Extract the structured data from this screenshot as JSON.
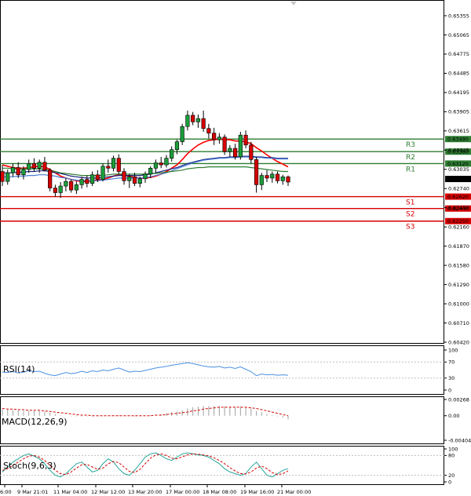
{
  "chart_data": {
    "type": "candlestick",
    "price_axis": {
      "ticks": [
        "0.65355",
        "0.65065",
        "0.64775",
        "0.64485",
        "0.64195",
        "0.63905",
        "0.63615",
        "0.63325",
        "0.63035",
        "0.62740",
        "0.62450",
        "0.62160",
        "0.61870",
        "0.61580",
        "0.61290",
        "0.61000",
        "0.60710",
        "0.60420"
      ],
      "range": [
        0.6035,
        0.6555
      ],
      "current_price": "0.62887"
    },
    "time_axis": {
      "labels": [
        "6:00",
        "9 Mar 21:01",
        "11 Mar 04:00",
        "12 Mar 12:00",
        "13 Mar 20:00",
        "17 Mar 00:00",
        "18 Mar 08:00",
        "19 Mar 16:00",
        "21 Mar 00:00"
      ]
    },
    "levels": [
      {
        "name": "R3",
        "value": 0.6349,
        "value_label": "0.63490",
        "color": "#2e7d32"
      },
      {
        "name": "R2",
        "value": 0.633,
        "value_label": "0.63300",
        "color": "#2e7d32"
      },
      {
        "name": "R1",
        "value": 0.6312,
        "value_label": "0.63120",
        "color": "#2e7d32"
      },
      {
        "name": "S1",
        "value": 0.6262,
        "value_label": "0.62620",
        "color": "#d50000"
      },
      {
        "name": "S2",
        "value": 0.6244,
        "value_label": "0.62440",
        "color": "#d50000"
      },
      {
        "name": "S3",
        "value": 0.6225,
        "value_label": "0.62250",
        "color": "#d50000"
      }
    ],
    "candles": [
      {
        "o": 0.63,
        "h": 0.631,
        "l": 0.6278,
        "c": 0.6285
      },
      {
        "o": 0.6285,
        "h": 0.6303,
        "l": 0.628,
        "c": 0.6298
      },
      {
        "o": 0.6298,
        "h": 0.6312,
        "l": 0.6292,
        "c": 0.6306
      },
      {
        "o": 0.6306,
        "h": 0.6314,
        "l": 0.629,
        "c": 0.6295
      },
      {
        "o": 0.6295,
        "h": 0.6308,
        "l": 0.6288,
        "c": 0.6303
      },
      {
        "o": 0.6303,
        "h": 0.6318,
        "l": 0.6298,
        "c": 0.6312
      },
      {
        "o": 0.6312,
        "h": 0.632,
        "l": 0.63,
        "c": 0.6305
      },
      {
        "o": 0.6305,
        "h": 0.6318,
        "l": 0.6298,
        "c": 0.6314
      },
      {
        "o": 0.6314,
        "h": 0.6322,
        "l": 0.63,
        "c": 0.6302
      },
      {
        "o": 0.6302,
        "h": 0.6305,
        "l": 0.627,
        "c": 0.6275
      },
      {
        "o": 0.6275,
        "h": 0.628,
        "l": 0.6262,
        "c": 0.6268
      },
      {
        "o": 0.6268,
        "h": 0.6284,
        "l": 0.626,
        "c": 0.6278
      },
      {
        "o": 0.6278,
        "h": 0.629,
        "l": 0.627,
        "c": 0.6285
      },
      {
        "o": 0.6285,
        "h": 0.6288,
        "l": 0.6268,
        "c": 0.6272
      },
      {
        "o": 0.6272,
        "h": 0.6285,
        "l": 0.6266,
        "c": 0.628
      },
      {
        "o": 0.628,
        "h": 0.6292,
        "l": 0.6274,
        "c": 0.6288
      },
      {
        "o": 0.6288,
        "h": 0.6294,
        "l": 0.6276,
        "c": 0.6282
      },
      {
        "o": 0.6282,
        "h": 0.63,
        "l": 0.6278,
        "c": 0.6295
      },
      {
        "o": 0.6295,
        "h": 0.6302,
        "l": 0.6284,
        "c": 0.6288
      },
      {
        "o": 0.6288,
        "h": 0.6312,
        "l": 0.6285,
        "c": 0.6308
      },
      {
        "o": 0.6308,
        "h": 0.6318,
        "l": 0.6298,
        "c": 0.6305
      },
      {
        "o": 0.6305,
        "h": 0.6324,
        "l": 0.63,
        "c": 0.632
      },
      {
        "o": 0.632,
        "h": 0.6326,
        "l": 0.6296,
        "c": 0.63
      },
      {
        "o": 0.63,
        "h": 0.6305,
        "l": 0.628,
        "c": 0.6286
      },
      {
        "o": 0.6286,
        "h": 0.6296,
        "l": 0.6275,
        "c": 0.6292
      },
      {
        "o": 0.6292,
        "h": 0.6298,
        "l": 0.6278,
        "c": 0.6282
      },
      {
        "o": 0.6282,
        "h": 0.6292,
        "l": 0.6276,
        "c": 0.6289
      },
      {
        "o": 0.6289,
        "h": 0.63,
        "l": 0.6283,
        "c": 0.6296
      },
      {
        "o": 0.6296,
        "h": 0.6308,
        "l": 0.629,
        "c": 0.6305
      },
      {
        "o": 0.6305,
        "h": 0.6318,
        "l": 0.6298,
        "c": 0.6313
      },
      {
        "o": 0.6313,
        "h": 0.6322,
        "l": 0.6305,
        "c": 0.631
      },
      {
        "o": 0.631,
        "h": 0.6325,
        "l": 0.6306,
        "c": 0.632
      },
      {
        "o": 0.632,
        "h": 0.6338,
        "l": 0.6315,
        "c": 0.6333
      },
      {
        "o": 0.6333,
        "h": 0.6348,
        "l": 0.6326,
        "c": 0.6345
      },
      {
        "o": 0.6345,
        "h": 0.6372,
        "l": 0.634,
        "c": 0.6368
      },
      {
        "o": 0.6368,
        "h": 0.6392,
        "l": 0.6362,
        "c": 0.6385
      },
      {
        "o": 0.6385,
        "h": 0.639,
        "l": 0.637,
        "c": 0.6375
      },
      {
        "o": 0.6375,
        "h": 0.6386,
        "l": 0.6366,
        "c": 0.638
      },
      {
        "o": 0.638,
        "h": 0.6392,
        "l": 0.636,
        "c": 0.6365
      },
      {
        "o": 0.6365,
        "h": 0.6372,
        "l": 0.635,
        "c": 0.6358
      },
      {
        "o": 0.6358,
        "h": 0.6366,
        "l": 0.634,
        "c": 0.6348
      },
      {
        "o": 0.6348,
        "h": 0.6358,
        "l": 0.6342,
        "c": 0.6352
      },
      {
        "o": 0.6352,
        "h": 0.6356,
        "l": 0.6325,
        "c": 0.633
      },
      {
        "o": 0.633,
        "h": 0.634,
        "l": 0.6322,
        "c": 0.6335
      },
      {
        "o": 0.6335,
        "h": 0.6342,
        "l": 0.6318,
        "c": 0.6322
      },
      {
        "o": 0.6322,
        "h": 0.636,
        "l": 0.6318,
        "c": 0.6355
      },
      {
        "o": 0.6355,
        "h": 0.6362,
        "l": 0.6335,
        "c": 0.634
      },
      {
        "o": 0.634,
        "h": 0.6345,
        "l": 0.6312,
        "c": 0.6318
      },
      {
        "o": 0.6318,
        "h": 0.6322,
        "l": 0.6268,
        "c": 0.628
      },
      {
        "o": 0.628,
        "h": 0.6298,
        "l": 0.6272,
        "c": 0.6294
      },
      {
        "o": 0.6294,
        "h": 0.6302,
        "l": 0.6284,
        "c": 0.629
      },
      {
        "o": 0.629,
        "h": 0.63,
        "l": 0.6283,
        "c": 0.6296
      },
      {
        "o": 0.6296,
        "h": 0.63,
        "l": 0.6282,
        "c": 0.6286
      },
      {
        "o": 0.6286,
        "h": 0.6295,
        "l": 0.628,
        "c": 0.6292
      },
      {
        "o": 0.6292,
        "h": 0.6294,
        "l": 0.6278,
        "c": 0.6284
      }
    ],
    "moving_averages": [
      {
        "color": "#ff0000",
        "values": [
          0.631,
          0.6308,
          0.6306,
          0.6305,
          0.6305,
          0.6306,
          0.6307,
          0.6308,
          0.6307,
          0.6303,
          0.6298,
          0.6293,
          0.629,
          0.6288,
          0.6286,
          0.6285,
          0.6285,
          0.6286,
          0.6287,
          0.6288,
          0.629,
          0.6293,
          0.6295,
          0.6294,
          0.6293,
          0.6291,
          0.629,
          0.629,
          0.6291,
          0.6293,
          0.6296,
          0.63,
          0.6305,
          0.631,
          0.6318,
          0.6327,
          0.6334,
          0.634,
          0.6344,
          0.6347,
          0.6348,
          0.6349,
          0.6348,
          0.6348,
          0.6346,
          0.6346,
          0.6345,
          0.6342,
          0.6336,
          0.6331,
          0.6325,
          0.632,
          0.6315,
          0.6311,
          0.6307
        ]
      },
      {
        "color": "#1a237e",
        "values": [
          0.6298,
          0.6298,
          0.6298,
          0.6299,
          0.6299,
          0.63,
          0.63,
          0.6301,
          0.6301,
          0.63,
          0.6298,
          0.6297,
          0.6295,
          0.6293,
          0.6292,
          0.6291,
          0.629,
          0.629,
          0.629,
          0.6291,
          0.6292,
          0.6293,
          0.6294,
          0.6294,
          0.6294,
          0.6294,
          0.6294,
          0.6295,
          0.6296,
          0.6298,
          0.63,
          0.6302,
          0.6304,
          0.6306,
          0.6309,
          0.6312,
          0.6314,
          0.6316,
          0.6318,
          0.6319,
          0.632,
          0.6321,
          0.6321,
          0.6322,
          0.6322,
          0.6323,
          0.6323,
          0.6323,
          0.6322,
          0.6322,
          0.6321,
          0.6321,
          0.632,
          0.632,
          0.632
        ]
      },
      {
        "color": "#4a7fd8",
        "values": [
          0.6292,
          0.6292,
          0.6292,
          0.6293,
          0.6293,
          0.6294,
          0.6294,
          0.6295,
          0.6295,
          0.6294,
          0.6293,
          0.6291,
          0.629,
          0.6288,
          0.6287,
          0.6286,
          0.6286,
          0.6286,
          0.6286,
          0.6287,
          0.6288,
          0.6289,
          0.629,
          0.629,
          0.629,
          0.629,
          0.629,
          0.6291,
          0.6292,
          0.6294,
          0.6296,
          0.6298,
          0.6301,
          0.6304,
          0.6307,
          0.631,
          0.6313,
          0.6315,
          0.6317,
          0.6318,
          0.6319,
          0.632,
          0.632,
          0.6321,
          0.6321,
          0.6322,
          0.6322,
          0.6322,
          0.6321,
          0.6321,
          0.632,
          0.632,
          0.6319,
          0.6319,
          0.6319
        ]
      },
      {
        "color": "#2e7d32",
        "values": [
          0.6305,
          0.6305,
          0.6304,
          0.6304,
          0.6304,
          0.6304,
          0.6304,
          0.6304,
          0.6303,
          0.6302,
          0.63,
          0.6298,
          0.6297,
          0.6296,
          0.6295,
          0.6294,
          0.6294,
          0.6294,
          0.6294,
          0.6294,
          0.6295,
          0.6296,
          0.6296,
          0.6296,
          0.6296,
          0.6296,
          0.6296,
          0.6296,
          0.6297,
          0.6297,
          0.6298,
          0.6299,
          0.63,
          0.6301,
          0.6302,
          0.6304,
          0.6305,
          0.6306,
          0.6306,
          0.6307,
          0.6307,
          0.6307,
          0.6307,
          0.6307,
          0.6307,
          0.6307,
          0.6307,
          0.6306,
          0.6305,
          0.6304,
          0.6303,
          0.6302,
          0.6301,
          0.63,
          0.63
        ]
      }
    ],
    "rsi": {
      "label": "RSI(14)",
      "ticks": [
        "100",
        "70",
        "30",
        "0"
      ],
      "levels": [
        70,
        30
      ],
      "values": [
        45,
        44,
        46,
        43,
        45,
        48,
        46,
        47,
        42,
        38,
        36,
        40,
        44,
        41,
        43,
        47,
        44,
        48,
        46,
        50,
        48,
        52,
        55,
        50,
        45,
        47,
        46,
        49,
        52,
        55,
        57,
        59,
        62,
        64,
        66,
        68,
        66,
        63,
        60,
        58,
        57,
        59,
        55,
        57,
        54,
        58,
        52,
        46,
        36,
        40,
        38,
        39,
        37,
        38,
        37
      ]
    },
    "macd": {
      "label": "MACD(12,26,9)",
      "ticks": [
        "0.00268",
        "0.00",
        "-0.00404"
      ],
      "range": [
        -0.00404,
        0.00268
      ],
      "histogram": [
        0.0011,
        0.001,
        0.0009,
        0.0009,
        0.0008,
        0.0008,
        0.0008,
        0.0008,
        0.0007,
        0.0005,
        0.0003,
        0.0001,
        0.0,
        -0.0001,
        -0.0001,
        -0.0001,
        -0.0001,
        -0.0001,
        -0.0001,
        0.0,
        0.0,
        0.0001,
        0.0001,
        0.0,
        0.0,
        -0.0001,
        -0.0001,
        0.0,
        0.0001,
        0.0002,
        0.0003,
        0.0004,
        0.0006,
        0.0007,
        0.0009,
        0.0012,
        0.0014,
        0.0015,
        0.0016,
        0.0016,
        0.0016,
        0.0016,
        0.0015,
        0.0015,
        0.0014,
        0.0015,
        0.0014,
        0.0012,
        0.0008,
        0.0006,
        0.0003,
        0.0001,
        -0.0001,
        -0.0003,
        -0.0006
      ],
      "signal": [
        0.0012,
        0.0011,
        0.0011,
        0.001,
        0.001,
        0.0009,
        0.0009,
        0.0009,
        0.0008,
        0.0007,
        0.0006,
        0.0005,
        0.0004,
        0.0003,
        0.0002,
        0.0001,
        0.0001,
        0.0,
        0.0,
        0.0,
        0.0,
        0.0,
        0.0,
        0.0,
        0.0,
        0.0,
        0.0,
        0.0,
        0.0,
        0.0001,
        0.0001,
        0.0002,
        0.0003,
        0.0004,
        0.0005,
        0.0006,
        0.0008,
        0.0009,
        0.0011,
        0.0012,
        0.0013,
        0.0014,
        0.0014,
        0.0014,
        0.0014,
        0.0014,
        0.0014,
        0.0013,
        0.0012,
        0.001,
        0.0008,
        0.0006,
        0.0004,
        0.0002,
        0.0
      ]
    },
    "stochastic": {
      "label": "Stoch(9,6,3)",
      "ticks": [
        "100",
        "80",
        "20",
        "0"
      ],
      "levels": [
        80,
        20
      ],
      "k": [
        30,
        45,
        60,
        70,
        80,
        85,
        78,
        70,
        55,
        35,
        20,
        15,
        25,
        40,
        55,
        60,
        45,
        30,
        35,
        55,
        70,
        60,
        40,
        25,
        20,
        35,
        55,
        75,
        85,
        88,
        80,
        70,
        65,
        75,
        85,
        88,
        85,
        82,
        80,
        75,
        65,
        55,
        40,
        30,
        25,
        20,
        25,
        45,
        60,
        40,
        20,
        15,
        25,
        35,
        40
      ],
      "d": [
        35,
        40,
        50,
        60,
        70,
        78,
        80,
        75,
        65,
        50,
        35,
        25,
        22,
        30,
        42,
        52,
        53,
        45,
        38,
        42,
        55,
        62,
        58,
        45,
        32,
        28,
        38,
        55,
        72,
        82,
        85,
        80,
        72,
        70,
        76,
        82,
        85,
        84,
        82,
        79,
        73,
        65,
        55,
        43,
        33,
        25,
        24,
        30,
        42,
        48,
        40,
        28,
        22,
        25,
        33
      ]
    }
  }
}
